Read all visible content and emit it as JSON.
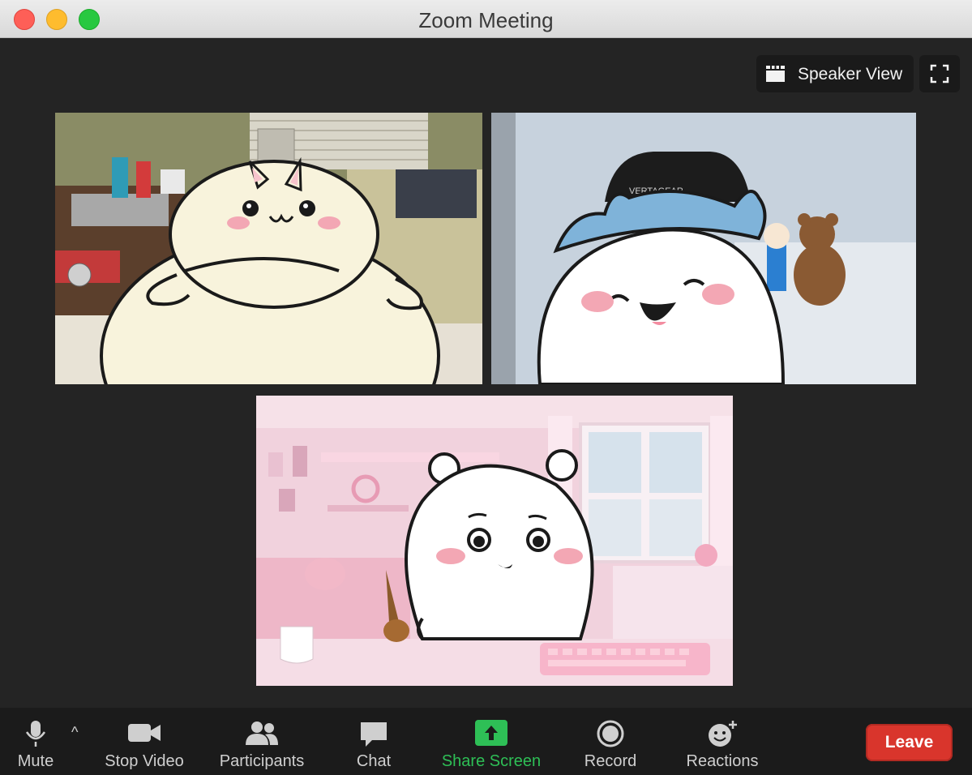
{
  "window": {
    "title": "Zoom Meeting"
  },
  "view": {
    "speaker_view_label": "Speaker View",
    "fullscreen_icon": "fullscreen-icon"
  },
  "tiles": [
    {
      "name": "participant-tile-1",
      "avatar": "bunny-character"
    },
    {
      "name": "participant-tile-2",
      "avatar": "cat-character",
      "chair_text": "VERTAGEAR"
    },
    {
      "name": "participant-tile-3",
      "avatar": "bear-character"
    }
  ],
  "toolbar": {
    "mute": "Mute",
    "stop_video": "Stop Video",
    "participants": "Participants",
    "chat": "Chat",
    "share_screen": "Share Screen",
    "record": "Record",
    "reactions": "Reactions",
    "leave": "Leave"
  },
  "colors": {
    "share_accent": "#2ebf56",
    "leave_red": "#d9352c",
    "background": "#242424"
  }
}
